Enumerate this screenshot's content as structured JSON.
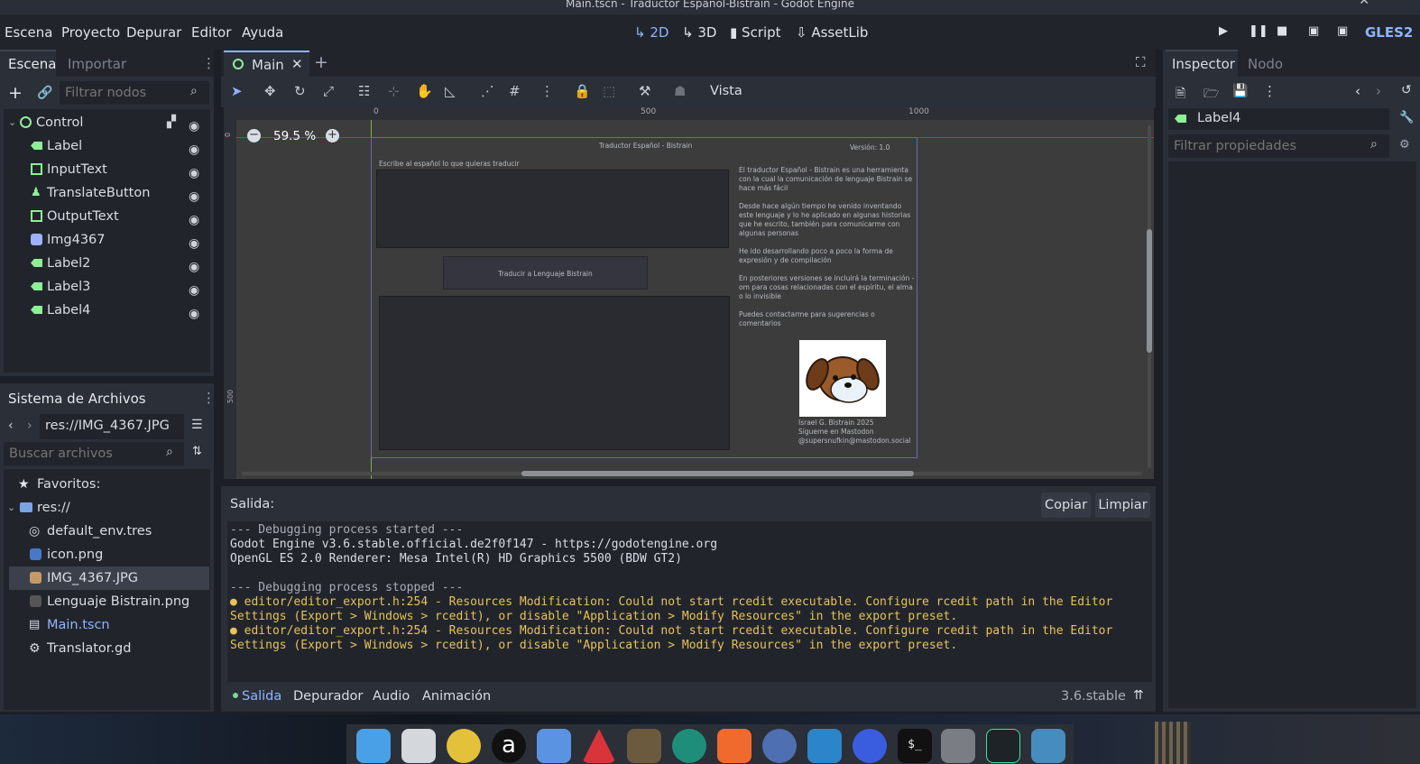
{
  "window": {
    "title": "Main.tscn - Traductor Español-Bistrain - Godot Engine"
  },
  "menu": [
    "Escena",
    "Proyecto",
    "Depurar",
    "Editor",
    "Ayuda"
  ],
  "modes": {
    "m2d": "2D",
    "m3d": "3D",
    "script": "Script",
    "assetlib": "AssetLib"
  },
  "renderer": "GLES2",
  "scene_dock": {
    "tabs": [
      "Escena",
      "Importar"
    ],
    "filter_placeholder": "Filtrar nodos",
    "nodes": [
      {
        "name": "Control",
        "icon": "control-icon"
      },
      {
        "name": "Label",
        "icon": "label-icon"
      },
      {
        "name": "InputText",
        "icon": "textedit-icon"
      },
      {
        "name": "TranslateButton",
        "icon": "button-icon"
      },
      {
        "name": "OutputText",
        "icon": "textedit-icon"
      },
      {
        "name": "Img4367",
        "icon": "sprite-icon"
      },
      {
        "name": "Label2",
        "icon": "label-icon"
      },
      {
        "name": "Label3",
        "icon": "label-icon"
      },
      {
        "name": "Label4",
        "icon": "label-icon"
      }
    ]
  },
  "filesystem": {
    "title": "Sistema de Archivos",
    "path": "res://IMG_4367.JPG",
    "search_placeholder": "Buscar archivos",
    "items": [
      {
        "name": "Favoritos:",
        "icon": "star-icon"
      },
      {
        "name": "res://",
        "icon": "folder-icon"
      },
      {
        "name": "default_env.tres",
        "icon": "environment-icon"
      },
      {
        "name": "icon.png",
        "icon": "image-icon"
      },
      {
        "name": "IMG_4367.JPG",
        "icon": "image-icon"
      },
      {
        "name": "Lenguaje Bistrain.png",
        "icon": "image-icon"
      },
      {
        "name": "Main.tscn",
        "icon": "scene-icon"
      },
      {
        "name": "Translator.gd",
        "icon": "gear-icon"
      }
    ]
  },
  "editor": {
    "tab": "Main",
    "view_label": "Vista",
    "zoom": "59.5 %",
    "ruler": [
      "0",
      "500",
      "1000"
    ],
    "ruler_v": [
      "0",
      "500"
    ]
  },
  "game": {
    "title": "Traductor Español - Bistrain",
    "version": "Versión: 1.0",
    "prompt": "Escribe al español lo que quieras traducir",
    "button": "Traducir a Lenguaje Bistrain",
    "p1": "El traductor Español - Bistrain es una herramienta con la cual la comunicación de lenguaje Bistrain se hace más fácil",
    "p2": "Desde hace algún tiempo he venido inventando este lenguaje y lo he aplicado en algunas historias que he escrito, también para comunicarme con algunas personas",
    "p3": "He ido desarrollando poco a poco la forma de expresión y de compilación",
    "p4": "En posteriores versiones se incluirá la terminación -om para cosas relacionadas con el espíritu, el alma o lo invisible",
    "p5": "Puedes contactarme para sugerencias o comentarios",
    "credit1": "Israel G. Bistrain 2025",
    "credit2": "Sígueme en Mastodon",
    "credit3": "@supersnufkin@mastodon.social"
  },
  "output": {
    "title": "Salida:",
    "copy": "Copiar",
    "clear": "Limpiar",
    "lines": [
      "--- Debugging process started ---",
      "Godot Engine v3.6.stable.official.de2f0f147 - https://godotengine.org",
      "OpenGL ES 2.0 Renderer: Mesa Intel(R) HD Graphics 5500 (BDW GT2)",
      "",
      "--- Debugging process stopped ---"
    ],
    "warnings": [
      "editor/editor_export.h:254 - Resources Modification: Could not start rcedit executable. Configure rcedit path in the Editor",
      "Settings (Export > Windows > rcedit), or disable \"Application > Modify Resources\" in the export preset.",
      "editor/editor_export.h:254 - Resources Modification: Could not start rcedit executable. Configure rcedit path in the Editor",
      "Settings (Export > Windows > rcedit), or disable \"Application > Modify Resources\" in the export preset."
    ],
    "warning_color": "#e8c15a"
  },
  "bottom_tabs": [
    "Salida",
    "Depurador",
    "Audio",
    "Animación"
  ],
  "version": "3.6.stable",
  "inspector": {
    "tabs": [
      "Inspector",
      "Nodo"
    ],
    "node": "Label4",
    "filter_placeholder": "Filtrar propiedades"
  },
  "colors": {
    "accent": "#8fb4ff",
    "node_green": "#8eef97",
    "panel": "#272b33"
  }
}
